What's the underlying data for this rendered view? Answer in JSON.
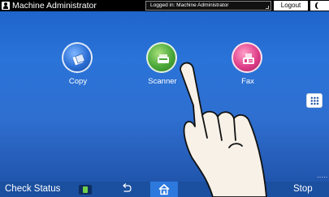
{
  "header": {
    "user_name": "Machine Administrator",
    "login_status": "Logged in: Machine Administrator",
    "logout_label": "Logout"
  },
  "apps": [
    {
      "label": "Copy",
      "icon": "copy-icon"
    },
    {
      "label": "Scanner",
      "icon": "scanner-icon"
    },
    {
      "label": "Fax",
      "icon": "fax-icon"
    }
  ],
  "footer": {
    "check_status_label": "Check Status",
    "stop_label": "Stop"
  },
  "overlay": {
    "icon": "pointing-hand"
  },
  "colors": {
    "background": "#2a73d8",
    "topbar": "#000000",
    "bottombar": "#1b4f9f",
    "home_active": "#2d79de",
    "copy": "#2b6fd6",
    "scanner": "#4aa83a",
    "fax": "#e0408a"
  }
}
